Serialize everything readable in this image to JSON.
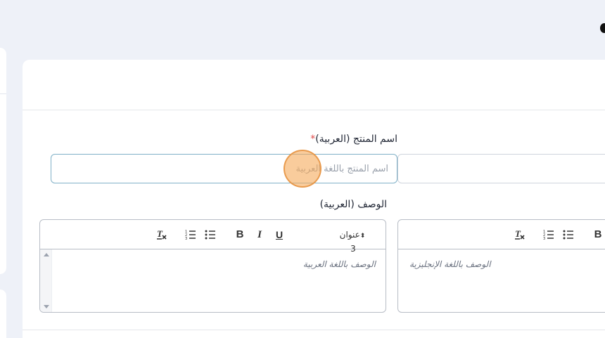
{
  "product_name_ar": {
    "label": "اسم المنتج (العربية)",
    "required_mark": "*",
    "placeholder": "اسم المنتج باللغة العربية",
    "value": ""
  },
  "product_name_en": {
    "placeholder": "",
    "value": ""
  },
  "description_ar": {
    "label": "الوصف (العربية)",
    "placeholder": "الوصف باللغة العربية",
    "toolbar": {
      "header_select": "عنوان 3",
      "bold": "B",
      "italic": "I",
      "underline": "U"
    }
  },
  "description_en": {
    "placeholder": "الوصف باللغة الإنجليزية",
    "toolbar": {
      "bold": "B"
    }
  },
  "colors": {
    "accent_focus": "#7fb0c7",
    "required": "#e14a4a",
    "click_indicator": "#f5aa5a"
  }
}
